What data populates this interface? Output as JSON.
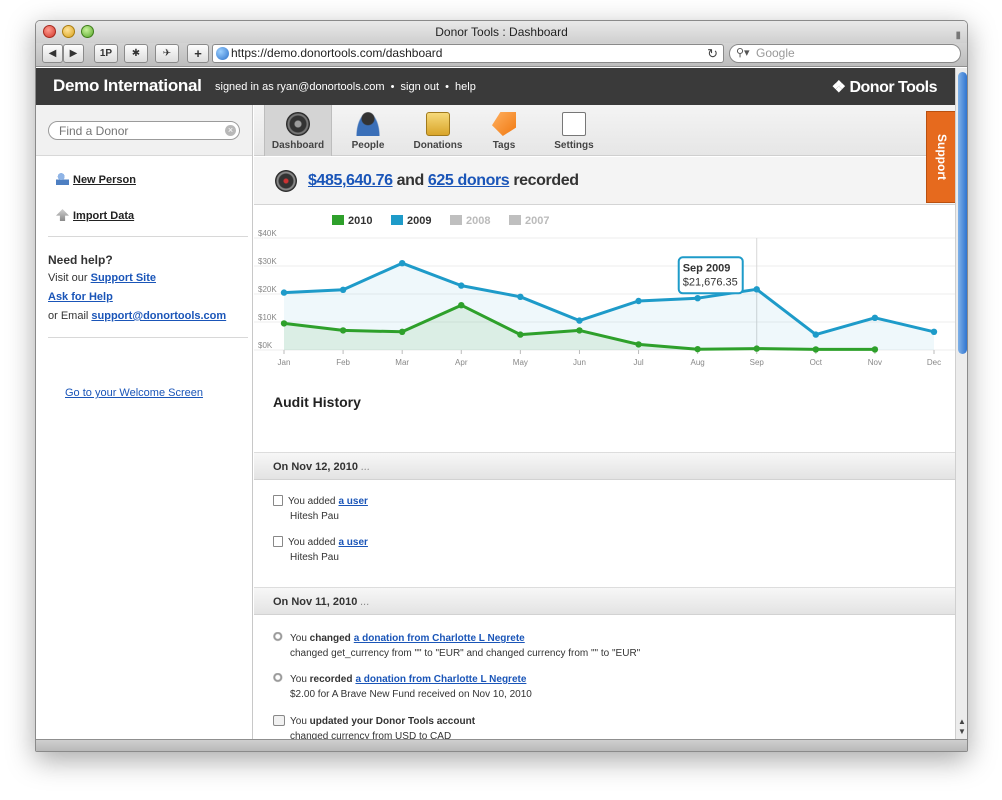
{
  "window": {
    "title": "Donor Tools : Dashboard",
    "url": "https://demo.donortools.com/dashboard",
    "search_placeholder": "Google",
    "toolbar_buttons": [
      "◀",
      "▶",
      "1P",
      "✱",
      "✈",
      "+"
    ]
  },
  "header": {
    "org_name": "Demo International",
    "signed_in": "signed in as ryan@donortools.com",
    "sign_out": "sign out",
    "help": "help",
    "brand": "Donor Tools",
    "separator": "•"
  },
  "sidebar": {
    "find_placeholder": "Find a Donor",
    "clear_icon": "ⓧ",
    "new_person": "New Person",
    "import_data": "Import Data",
    "help_heading": "Need help?",
    "visit_text": "Visit our",
    "support_site": "Support Site",
    "ask_for_help": "Ask for Help",
    "or_email": "or Email",
    "support_email": "support@donortools.com",
    "welcome_link": "Go to your Welcome Screen"
  },
  "nav": {
    "items": [
      {
        "label": "Dashboard",
        "icon": "dashboard-icon"
      },
      {
        "label": "People",
        "icon": "people-icon"
      },
      {
        "label": "Donations",
        "icon": "donations-icon"
      },
      {
        "label": "Tags",
        "icon": "tags-icon"
      },
      {
        "label": "Settings",
        "icon": "settings-icon"
      }
    ],
    "support_tab": "Support"
  },
  "summary": {
    "amount": "$485,640.76",
    "and": "and",
    "donors": "625 donors",
    "recorded": "recorded"
  },
  "chart_data": {
    "type": "line",
    "categories": [
      "Jan",
      "Feb",
      "Mar",
      "Apr",
      "May",
      "Jun",
      "Jul",
      "Aug",
      "Sep",
      "Oct",
      "Nov",
      "Dec"
    ],
    "y_ticks": [
      "$40K",
      "$30K",
      "$20K",
      "$10K",
      "$0K"
    ],
    "ylim": [
      0,
      40000
    ],
    "legend": [
      {
        "name": "2010",
        "color": "#2ea02b",
        "active": true
      },
      {
        "name": "2009",
        "color": "#1e9bc9",
        "active": true
      },
      {
        "name": "2008",
        "color": "#bfbfbf",
        "active": false
      },
      {
        "name": "2007",
        "color": "#bfbfbf",
        "active": false
      }
    ],
    "series": [
      {
        "name": "2010",
        "color": "#2ea02b",
        "values": [
          9500,
          7000,
          6500,
          16000,
          5500,
          7000,
          2000,
          300,
          500,
          200,
          200,
          null
        ]
      },
      {
        "name": "2009",
        "color": "#1e9bc9",
        "values": [
          20500,
          21500,
          31000,
          23000,
          19000,
          10500,
          17500,
          18500,
          21676.35,
          5500,
          11500,
          6500
        ]
      }
    ],
    "tooltip": {
      "title": "Sep 2009",
      "value": "$21,676.35",
      "index": 8,
      "series": "2009"
    },
    "legend_position": "top-left",
    "grid": true
  },
  "audit": {
    "title": "Audit History",
    "days": [
      {
        "date_label": "On Nov 12, 2010",
        "ellipsis": "...",
        "entries": [
          {
            "prefix": "You added",
            "link": "a user",
            "detail": "Hitesh Pau"
          },
          {
            "prefix": "You added",
            "link": "a user",
            "detail": "Hitesh Pau"
          }
        ]
      },
      {
        "date_label": "On Nov 11, 2010",
        "ellipsis": "...",
        "entries": [
          {
            "you": "You",
            "verb": "changed",
            "link": "a donation from Charlotte L Negrete",
            "detail": "changed get_currency from \"\" to \"EUR\" and changed currency from \"\" to \"EUR\""
          },
          {
            "you": "You",
            "verb": "recorded",
            "link": "a donation from Charlotte L Negrete",
            "detail": "$2.00 for A Brave New Fund received on Nov 10, 2010"
          },
          {
            "you": "You",
            "verb": "updated your Donor Tools account",
            "detail": "changed currency from USD to CAD"
          }
        ]
      }
    ]
  }
}
